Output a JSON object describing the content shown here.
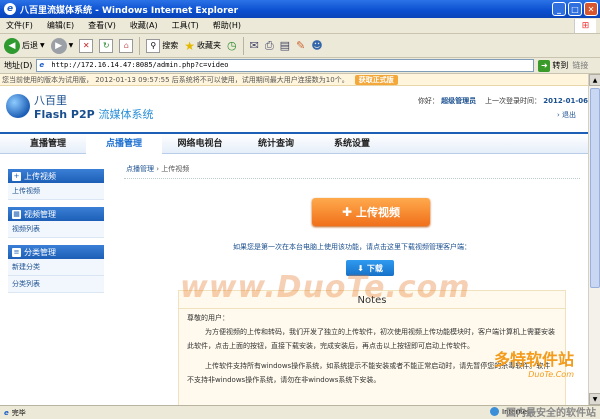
{
  "window": {
    "title": "八百里流媒体系统 - Windows Internet Explorer"
  },
  "menu": [
    "文件(F)",
    "编辑(E)",
    "查看(V)",
    "收藏(A)",
    "工具(T)",
    "帮助(H)"
  ],
  "toolbar": {
    "back": "后退",
    "search": "搜索",
    "favorites": "收藏夹"
  },
  "address": {
    "label": "地址(D)",
    "url": "http://172.16.14.47:8085/admin.php?c=video",
    "go": "转到",
    "links": "链接"
  },
  "notice": {
    "text": "您当前使用的版本为试用版，  2012-01-13 09:57:55 后系统将不可以使用，试用期间最大用户连接数为10个。",
    "buy": "获取正式版"
  },
  "brand": {
    "name": "八百里",
    "product_a": "Flash P2P",
    "product_b": "流媒体系统"
  },
  "user": {
    "greeting": "你好：",
    "name": "超级管理员",
    "last_login_label": "上一次登录时间：",
    "last_login": "2012-01-06",
    "logout": "退出"
  },
  "nav": [
    "直播管理",
    "点播管理",
    "网络电视台",
    "统计查询",
    "系统设置"
  ],
  "sidebar": [
    {
      "title": "上传视频",
      "items": [
        "上传视频"
      ]
    },
    {
      "title": "视频管理",
      "items": [
        "视频列表"
      ]
    },
    {
      "title": "分类管理",
      "items": [
        "新建分类",
        "分类列表"
      ]
    }
  ],
  "breadcrumb": {
    "root": "点播管理",
    "current": "上传视频"
  },
  "main": {
    "upload_label": "上传视频",
    "hint": "如果您是第一次在本台电脑上使用该功能，请点击这里下载视频管理客户端：",
    "download_label": "下载"
  },
  "notes": {
    "title": "Notes",
    "salutation": "尊敬的用户：",
    "p1": "为方便视频的上传和转码，我们开发了独立的上传软件，初次使用视频上传功能模块时，客户端计算机上需要安装此软件，点击上面的按钮，直接下载安装，完成安装后，再点击以上按钮即可启动上传软件。",
    "p2": "上传软件支持所有windows操作系统，如系统提示不能安装或者不能正常启动时，请先暂停您的杀毒软件。软件不支持非windows操作系统，请勿在非windows系统下安装。"
  },
  "watermarks": {
    "center": "www.DuoTe.com",
    "logo": "多特软件站",
    "domain": "DuoTe.Com",
    "bottom": "国内最安全的软件站"
  },
  "status": {
    "text": "完毕",
    "zone": "Internet"
  }
}
